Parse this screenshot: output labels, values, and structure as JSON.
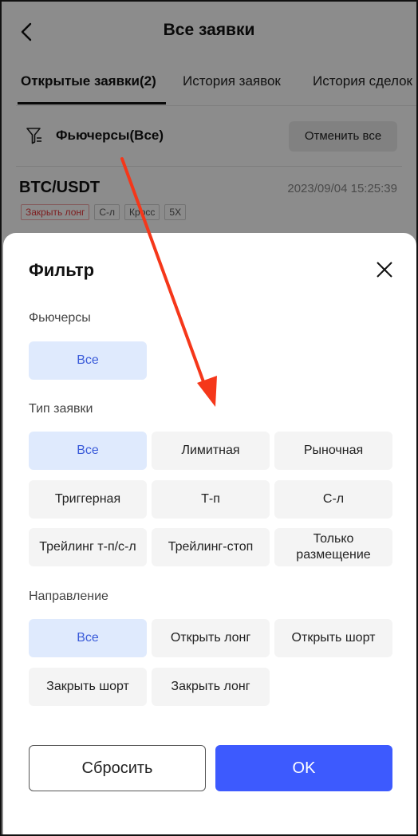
{
  "header": {
    "title": "Все заявки"
  },
  "tabs": [
    {
      "label": "Открытые заявки(2)",
      "active": true
    },
    {
      "label": "История заявок",
      "active": false
    },
    {
      "label": "История сделок",
      "active": false
    }
  ],
  "filter_bar": {
    "label": "Фьючерсы(Все)",
    "cancel_all_label": "Отменить все"
  },
  "order": {
    "pair": "BTC/USDT",
    "time": "2023/09/04 15:25:39",
    "tags": [
      "Закрыть лонг",
      "С-л",
      "Кросс",
      "5X"
    ]
  },
  "sheet": {
    "title": "Фильтр",
    "futures": {
      "label": "Фьючерсы",
      "options": [
        "Все"
      ]
    },
    "order_type": {
      "label": "Тип заявки",
      "options": [
        "Все",
        "Лимитная",
        "Рыночная",
        "Триггерная",
        "Т-п",
        "С-л",
        "Трейлинг т-п/с-л",
        "Трейлинг-стоп",
        "Только размещение"
      ]
    },
    "direction": {
      "label": "Направление",
      "options": [
        "Все",
        "Открыть лонг",
        "Открыть шорт",
        "Закрыть шорт",
        "Закрыть лонг"
      ]
    },
    "reset_label": "Сбросить",
    "ok_label": "OK"
  },
  "colors": {
    "accent": "#3d5afe",
    "selected_chip_bg": "#dfeafd",
    "selected_chip_text": "#3a5bd9",
    "annotation_arrow": "#f5371a",
    "tag_red": "#e5383b"
  }
}
